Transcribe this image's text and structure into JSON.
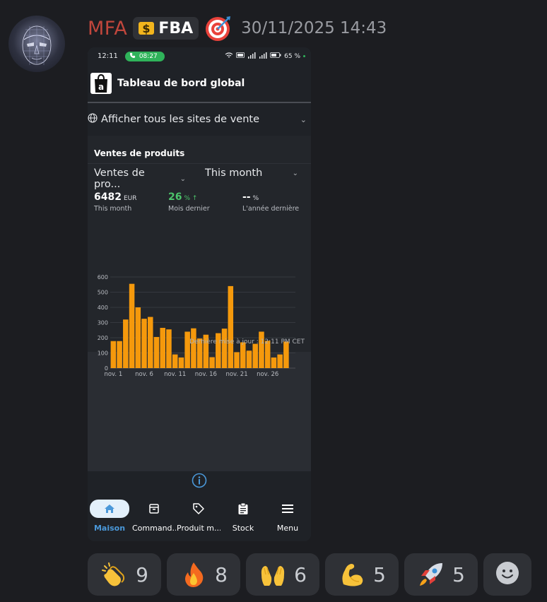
{
  "message": {
    "username": "MFA",
    "tag": {
      "emoji": "money-bag-icon",
      "text": "FBA"
    },
    "badge_emoji": "target-icon",
    "timestamp": "30/11/2025 14:43"
  },
  "phone": {
    "status_bar": {
      "time": "12:11",
      "call_timer": "08:27",
      "battery": "65 %"
    },
    "app_title": "Tableau de bord global",
    "site_selector": "Afficher tous les sites de vente",
    "card": {
      "title": "Ventes de produits",
      "metric_select": "Ventes de pro...",
      "period_select": "This month",
      "metrics": [
        {
          "value": "6482",
          "unit": "EUR",
          "label": "This month"
        },
        {
          "value": "26",
          "unit": "% ↑",
          "label": "Mois dernier"
        },
        {
          "value": "--",
          "unit": "%",
          "label": "L'année dernière"
        }
      ],
      "last_update": "Dernière mise à jour : 12:11 PM CET"
    },
    "bottom_nav": [
      {
        "label": "Maison",
        "icon": "home-icon",
        "active": true
      },
      {
        "label": "Command...",
        "icon": "box-icon",
        "active": false
      },
      {
        "label": "Produit m...",
        "icon": "tag-icon",
        "active": false
      },
      {
        "label": "Stock",
        "icon": "clipboard-icon",
        "active": false
      },
      {
        "label": "Menu",
        "icon": "menu-icon",
        "active": false
      }
    ]
  },
  "chart_data": {
    "type": "bar",
    "x": [
      1,
      2,
      3,
      4,
      5,
      6,
      7,
      8,
      9,
      10,
      11,
      12,
      13,
      14,
      15,
      16,
      17,
      18,
      19,
      20,
      21,
      22,
      23,
      24,
      25,
      26,
      27,
      28,
      29,
      30
    ],
    "values": [
      178,
      178,
      320,
      555,
      400,
      325,
      337,
      205,
      265,
      255,
      90,
      70,
      240,
      262,
      195,
      220,
      72,
      230,
      260,
      540,
      105,
      170,
      115,
      160,
      240,
      180,
      70,
      90,
      175,
      0
    ],
    "tick_labels": [
      "nov. 1",
      "nov. 6",
      "nov. 11",
      "nov. 16",
      "nov. 21",
      "nov. 26"
    ],
    "tick_positions": [
      1,
      6,
      11,
      16,
      21,
      26
    ],
    "y_ticks": [
      0,
      100,
      200,
      300,
      400,
      500,
      600
    ],
    "ylim": [
      0,
      600
    ],
    "grid": true,
    "bar_color": "#f5990c"
  },
  "reactions": [
    {
      "emoji": "clapping-hands-icon",
      "count": "9"
    },
    {
      "emoji": "fire-icon",
      "count": "8"
    },
    {
      "emoji": "raised-hands-icon",
      "count": "6"
    },
    {
      "emoji": "flexed-biceps-icon",
      "count": "5"
    },
    {
      "emoji": "rocket-icon",
      "count": "5"
    }
  ]
}
